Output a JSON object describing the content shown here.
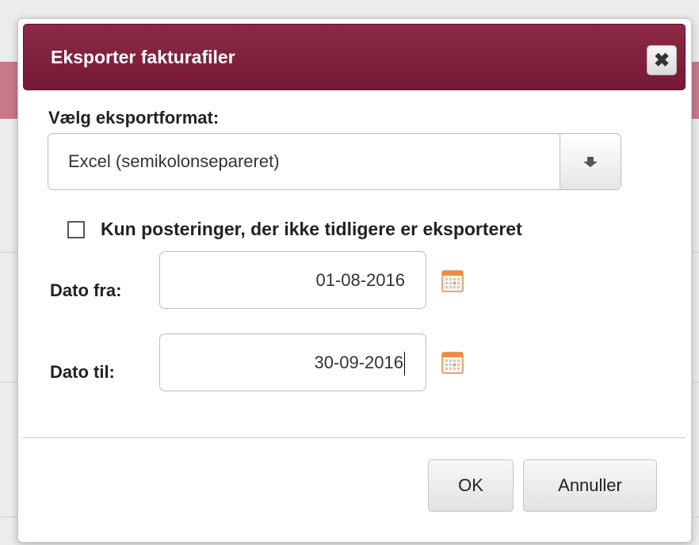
{
  "dialog": {
    "title": "Eksporter fakturafiler",
    "close_icon": "close-icon",
    "format_label": "Vælg eksportformat:",
    "format_value": "Excel (semikolonsepareret)",
    "checkbox_label": "Kun posteringer, der ikke tidligere er eksporteret",
    "checkbox_checked": false,
    "date_from_label": "Dato fra:",
    "date_from_value": "01-08-2016",
    "date_to_label": "Dato til:",
    "date_to_value": "30-09-2016",
    "ok_label": "OK",
    "cancel_label": "Annuller"
  },
  "colors": {
    "titlebar": "#7f1f3a",
    "calendar_accent": "#f08a3c"
  }
}
